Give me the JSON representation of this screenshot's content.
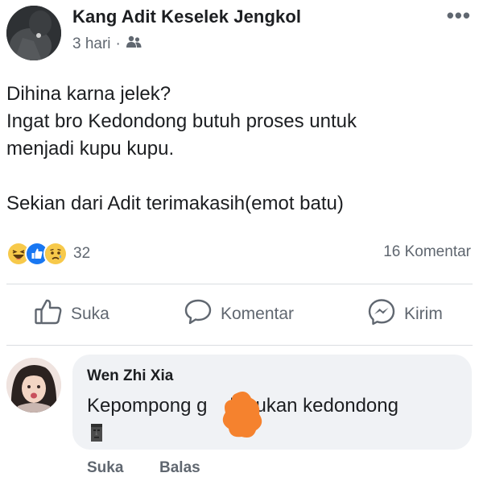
{
  "post": {
    "author": "Kang Adit Keselek Jengkol",
    "time": "3 hari",
    "separator": "·",
    "audience_icon": "friends-icon",
    "more_icon": "more-options-icon",
    "more_label": "•••",
    "text_lines": [
      "Dihina karna jelek?",
      "Ingat bro Kedondong butuh proses untuk",
      "menjadi kupu kupu.",
      "",
      "Sekian dari Adit terimakasih(emot batu)"
    ]
  },
  "reactions": {
    "icons": [
      "haha-reaction-icon",
      "like-reaction-icon",
      "sad-reaction-icon"
    ],
    "count": "32",
    "comments_count": "16 Komentar"
  },
  "actions": {
    "like": {
      "label": "Suka",
      "icon": "thumbs-up-icon"
    },
    "comment": {
      "label": "Komentar",
      "icon": "speech-bubble-icon"
    },
    "send": {
      "label": "Kirim",
      "icon": "messenger-icon"
    }
  },
  "comment": {
    "author": "Wen Zhi Xia",
    "text_before": "Kepompong g",
    "text_after": "k bukan kedondong",
    "emoji_icon": "moai-icon",
    "like_label": "Suka",
    "reply_label": "Balas"
  },
  "colors": {
    "text": "#1c1e21",
    "secondary": "#606770",
    "bubble": "#f0f2f5",
    "divider": "#dadde1",
    "like_blue": "#1877f2",
    "haha_yellow": "#f7c94a",
    "scribble_orange": "#f5822e"
  }
}
